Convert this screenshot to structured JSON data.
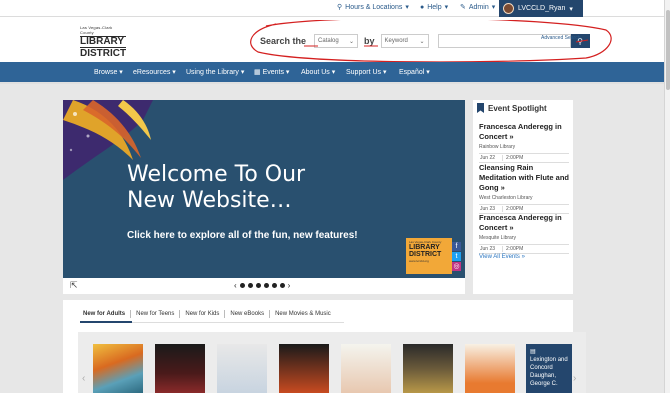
{
  "utility": {
    "hours": "Hours & Locations",
    "help": "Help",
    "admin": "Admin",
    "user": "LVCCLD_Ryan"
  },
  "logo": {
    "line1": "Las Vegas-Clark County",
    "line2": "LIBRARY",
    "line3": "DISTRICT"
  },
  "search": {
    "label": "Search the",
    "scope": "Catalog",
    "by": "by",
    "field": "Keyword",
    "advanced": "Advanced Search"
  },
  "nav": [
    "Browse",
    "eResources",
    "Using the Library",
    "Events",
    "About Us",
    "Support Us",
    "Español"
  ],
  "hero": {
    "title_line1": "Welcome To Our",
    "title_line2": "New Website…",
    "subtitle": "Click here to explore all of the fun, new features!",
    "badge_top": "Las Vegas-Clark County",
    "badge_l1": "LIBRARY",
    "badge_l2": "DISTRICT",
    "badge_url": "www.lvccld.org"
  },
  "events": {
    "title": "Event Spotlight",
    "items": [
      {
        "title": "Francesca Anderegg in Concert »",
        "location": "Rainbow Library",
        "date": "Jun 22",
        "time": "2:00PM"
      },
      {
        "title": "Cleansing Rain Meditation with Flute and Gong »",
        "location": "West Charleston Library",
        "date": "Jun 23",
        "time": "2:00PM"
      },
      {
        "title": "Francesca Anderegg in Concert »",
        "location": "Mesquite Library",
        "date": "Jun 23",
        "time": "2:00PM"
      }
    ],
    "view_all": "View All Events »"
  },
  "tabs": [
    "New for Adults",
    "New for Teens",
    "New for Kids",
    "New eBooks",
    "New Movies & Music"
  ],
  "books": {
    "selected": "Lexington and Concord Daughan, George C."
  },
  "colors": {
    "nav": "#2f6497",
    "dark_blue": "#24466d",
    "hero": "#29506f"
  }
}
